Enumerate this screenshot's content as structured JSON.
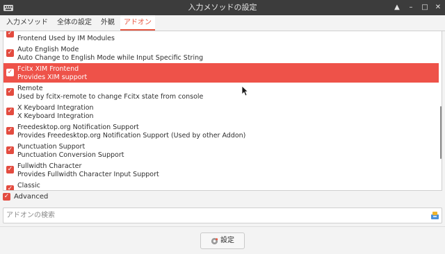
{
  "window": {
    "title": "入力メソッドの設定",
    "controls": [
      "▲",
      "–",
      "□",
      "✕"
    ]
  },
  "tabs": [
    {
      "label": "入力メソッド",
      "active": false
    },
    {
      "label": "全体の設定",
      "active": false
    },
    {
      "label": "外観",
      "active": false
    },
    {
      "label": "アドオン",
      "active": true
    }
  ],
  "addons": {
    "items": [
      {
        "name": "",
        "description": "Frontend Used by IM Modules",
        "enabled": true,
        "selected": false
      },
      {
        "name": "Auto English Mode",
        "description": "Auto Change to English Mode while Input Specific String",
        "enabled": true,
        "selected": false
      },
      {
        "name": "Fcitx XIM Frontend",
        "description": "Provides XIM support",
        "enabled": true,
        "selected": true
      },
      {
        "name": "Remote",
        "description": "Used by fcitx-remote to change Fcitx state from console",
        "enabled": true,
        "selected": false
      },
      {
        "name": "X Keyboard Integration",
        "description": "X Keyboard Integration",
        "enabled": true,
        "selected": false
      },
      {
        "name": "Freedesktop.org Notification Support",
        "description": "Provides Freedesktop.org Notification Support (Used by other Addon)",
        "enabled": true,
        "selected": false
      },
      {
        "name": "Punctuation Support",
        "description": "Punctuation Conversion Support",
        "enabled": true,
        "selected": false
      },
      {
        "name": "Fullwidth Character",
        "description": "Provides Fullwidth Character Input Support",
        "enabled": true,
        "selected": false
      },
      {
        "name": "Classic",
        "description": "",
        "enabled": true,
        "selected": false
      }
    ],
    "check_glyph": "✓"
  },
  "advanced": {
    "label": "Advanced",
    "checked": true
  },
  "search": {
    "placeholder": "アドオンの検索",
    "value": ""
  },
  "configure_button": {
    "label": "設定"
  },
  "colors": {
    "accent": "#e8553f",
    "selection": "#ee5249",
    "titlebar": "#3c3c3c"
  }
}
